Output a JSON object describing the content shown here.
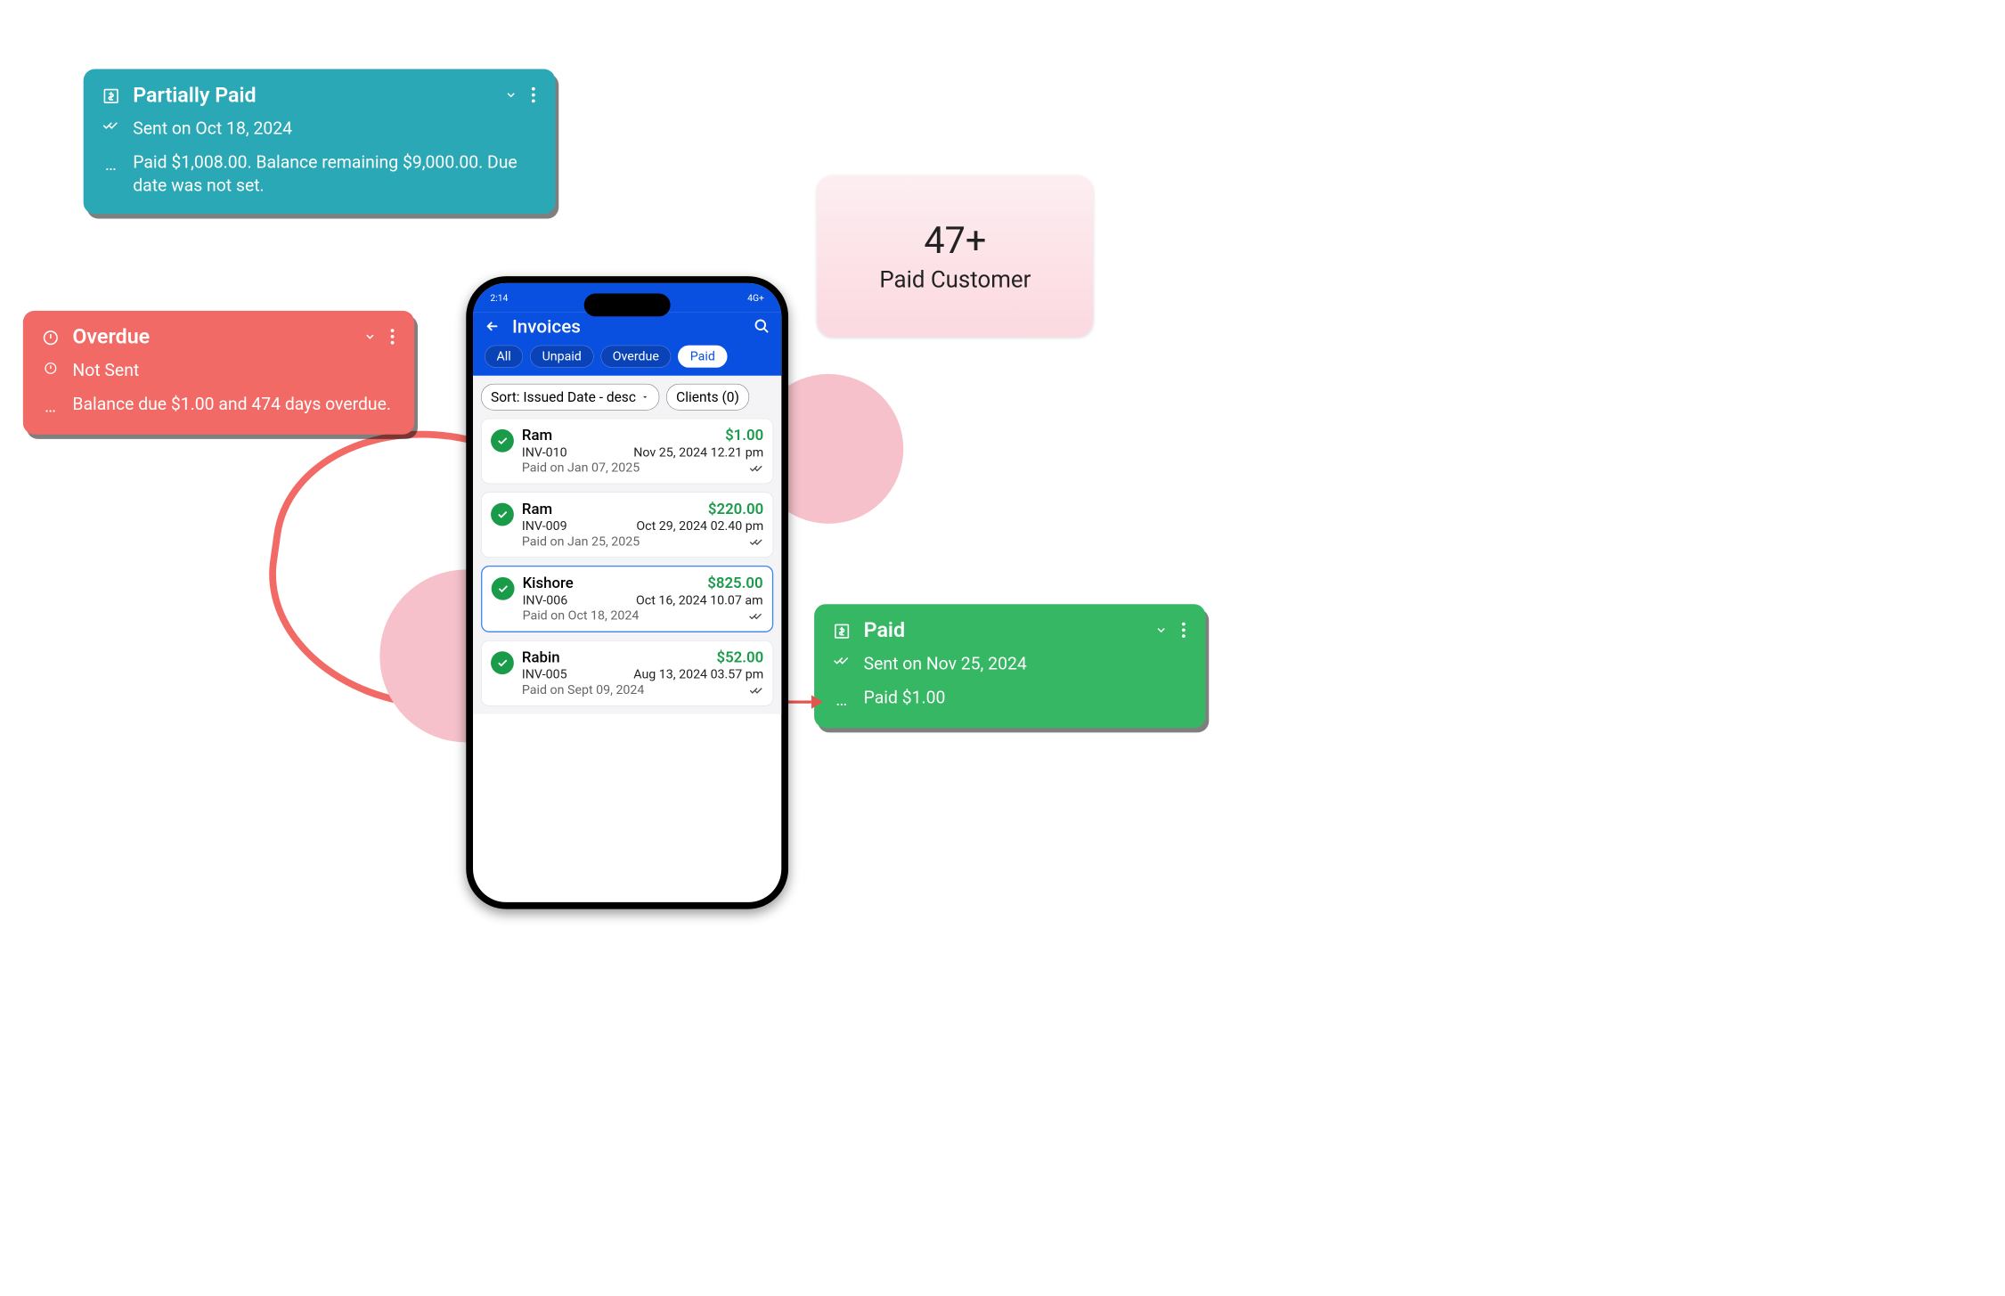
{
  "cards": {
    "teal": {
      "title": "Partially Paid",
      "sent": "Sent on Oct 18, 2024",
      "detail": "Paid $1,008.00. Balance remaining $9,000.00. Due date was not set."
    },
    "red": {
      "title": "Overdue",
      "sent": "Not Sent",
      "detail": "Balance due $1.00 and 474 days overdue."
    },
    "green": {
      "title": "Paid",
      "sent": "Sent on Nov 25, 2024",
      "detail": "Paid $1.00"
    }
  },
  "stat": {
    "value": "47+",
    "label": "Paid Customer"
  },
  "phone": {
    "statusbar": {
      "time": "2:14",
      "right": "4G+"
    },
    "title": "Invoices",
    "tabs": [
      "All",
      "Unpaid",
      "Overdue",
      "Paid"
    ],
    "active_tab": "Paid",
    "sort_label": "Sort: Issued Date - desc",
    "clients_label": "Clients (0)",
    "invoices": [
      {
        "name": "Ram",
        "amount": "$1.00",
        "ref": "INV-010",
        "issued": "Nov 25, 2024 12.21 pm",
        "paid": "Paid on Jan 07, 2025"
      },
      {
        "name": "Ram",
        "amount": "$220.00",
        "ref": "INV-009",
        "issued": "Oct 29, 2024 02.40 pm",
        "paid": "Paid on Jan 25, 2025"
      },
      {
        "name": "Kishore",
        "amount": "$825.00",
        "ref": "INV-006",
        "issued": "Oct 16, 2024 10.07 am",
        "paid": "Paid on Oct 18, 2024"
      },
      {
        "name": "Rabin",
        "amount": "$52.00",
        "ref": "INV-005",
        "issued": "Aug 13, 2024 03.57 pm",
        "paid": "Paid on Sept 09, 2024"
      }
    ],
    "selected_index": 2
  }
}
